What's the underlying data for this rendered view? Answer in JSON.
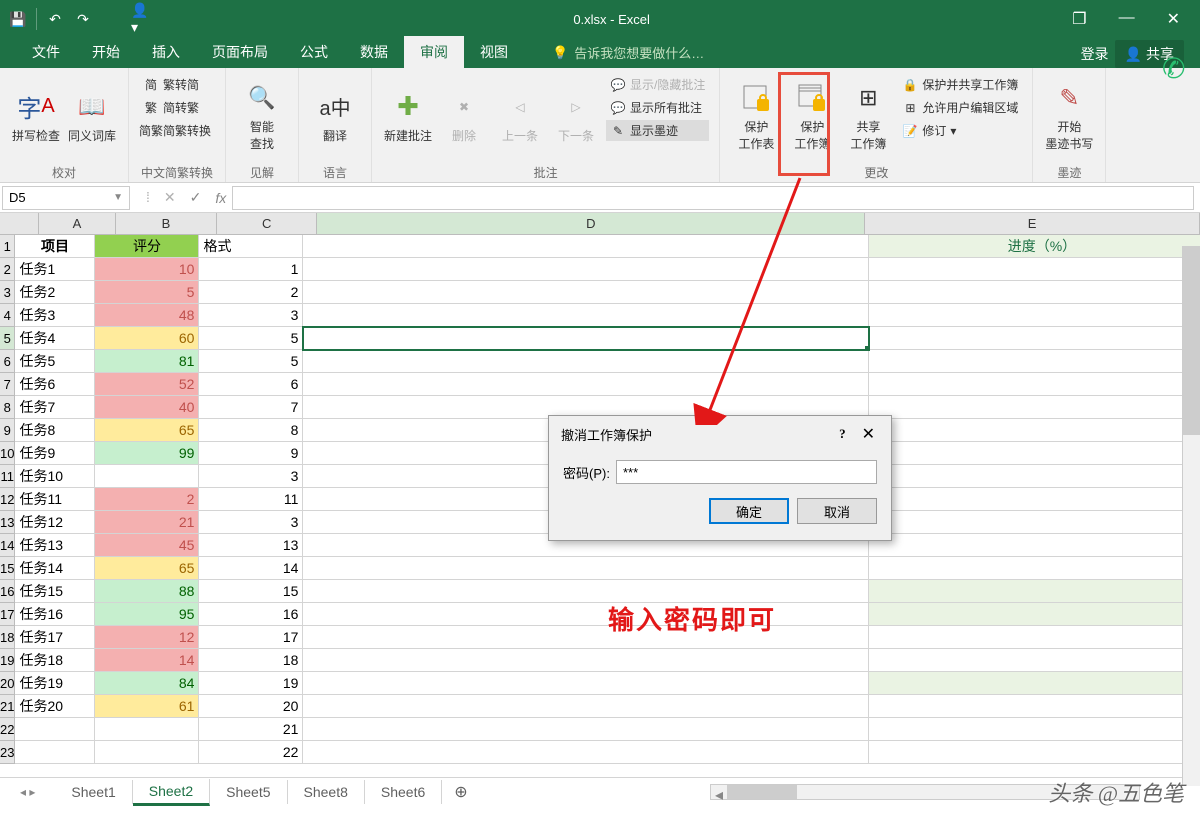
{
  "title": "0.xlsx - Excel",
  "qat": {
    "save": "💾",
    "undo": "↶",
    "redo": "↷",
    "user": "👤▾"
  },
  "win": {
    "restore": "❐",
    "min": "—",
    "close": "✕"
  },
  "tabs": {
    "file": "文件",
    "home": "开始",
    "insert": "插入",
    "layout": "页面布局",
    "formulas": "公式",
    "data": "数据",
    "review": "审阅",
    "view": "视图"
  },
  "tellme": "告诉我您想要做什么…",
  "login": "登录",
  "share": "共享",
  "ribbon": {
    "proof": {
      "spell": "拼写检查",
      "thesaurus": "同义词库",
      "label": "校对"
    },
    "cnconv": {
      "b1": "繁转简",
      "b2": "简转繁",
      "b3": "简繁转换",
      "label": "中文简繁转换"
    },
    "insights": {
      "smart": "智能\n查找",
      "label": "见解"
    },
    "lang": {
      "translate": "翻译",
      "label": "语言"
    },
    "comments": {
      "new": "新建批注",
      "del": "删除",
      "prev": "上一条",
      "next": "下一条",
      "tgl1": "显示/隐藏批注",
      "tgl2": "显示所有批注",
      "ink": "显示墨迹",
      "label": "批注"
    },
    "protect": {
      "sheet": "保护\n工作表",
      "workbook": "保护\n工作簿",
      "sharewb": "共享\n工作簿",
      "pshare": "保护并共享工作簿",
      "allow": "允许用户编辑区域",
      "track": "修订",
      "label": "更改"
    },
    "ink": {
      "start": "开始\n墨迹书写",
      "label": "墨迹"
    }
  },
  "namebox": "D5",
  "fx": {
    "down": "⁞",
    "cancel": "✕",
    "enter": "✓",
    "fx": "fx"
  },
  "cols": [
    "A",
    "B",
    "C",
    "D",
    "E"
  ],
  "headers": {
    "a": "项目",
    "b": "评分",
    "c": "格式",
    "e": "进度（%）"
  },
  "rows": [
    {
      "a": "任务1",
      "b": "10",
      "bcls": "red-bg",
      "c": "1"
    },
    {
      "a": "任务2",
      "b": "5",
      "bcls": "red-bg",
      "c": "2"
    },
    {
      "a": "任务3",
      "b": "48",
      "bcls": "red-bg",
      "c": "3"
    },
    {
      "a": "任务4",
      "b": "60",
      "bcls": "yel-bg",
      "c": "5"
    },
    {
      "a": "任务5",
      "b": "81",
      "bcls": "grn-bg",
      "c": "5"
    },
    {
      "a": "任务6",
      "b": "52",
      "bcls": "red-bg",
      "c": "6"
    },
    {
      "a": "任务7",
      "b": "40",
      "bcls": "red-bg",
      "c": "7"
    },
    {
      "a": "任务8",
      "b": "65",
      "bcls": "yel-bg",
      "c": "8"
    },
    {
      "a": "任务9",
      "b": "99",
      "bcls": "grn-bg",
      "c": "9"
    },
    {
      "a": "任务10",
      "b": "",
      "bcls": "",
      "c": "3"
    },
    {
      "a": "任务11",
      "b": "2",
      "bcls": "red-bg",
      "c": "11"
    },
    {
      "a": "任务12",
      "b": "21",
      "bcls": "red-bg",
      "c": "3"
    },
    {
      "a": "任务13",
      "b": "45",
      "bcls": "red-bg",
      "c": "13"
    },
    {
      "a": "任务14",
      "b": "65",
      "bcls": "yel-bg",
      "c": "14"
    },
    {
      "a": "任务15",
      "b": "88",
      "bcls": "grn-bg",
      "c": "15",
      "elight": true
    },
    {
      "a": "任务16",
      "b": "95",
      "bcls": "grn-bg",
      "c": "16",
      "elight": true
    },
    {
      "a": "任务17",
      "b": "12",
      "bcls": "red-bg",
      "c": "17"
    },
    {
      "a": "任务18",
      "b": "14",
      "bcls": "red-bg",
      "c": "18"
    },
    {
      "a": "任务19",
      "b": "84",
      "bcls": "grn-bg",
      "c": "19",
      "elight": true
    },
    {
      "a": "任务20",
      "b": "61",
      "bcls": "yel-bg",
      "c": "20"
    },
    {
      "a": "",
      "b": "",
      "bcls": "",
      "c": "21"
    },
    {
      "a": "",
      "b": "",
      "bcls": "",
      "c": "22"
    }
  ],
  "dialog": {
    "title": "撤消工作簿保护",
    "pwd_label": "密码(P):",
    "pwd_val": "***",
    "ok": "确定",
    "cancel": "取消",
    "help": "?",
    "close": "✕"
  },
  "annot": "输入密码即可",
  "sheets": {
    "s1": "Sheet1",
    "s2": "Sheet2",
    "s5": "Sheet5",
    "s8": "Sheet8",
    "s6": "Sheet6",
    "nav": "◂ ▸",
    "add": "⊕"
  },
  "watermark": "头条 @五色笔"
}
